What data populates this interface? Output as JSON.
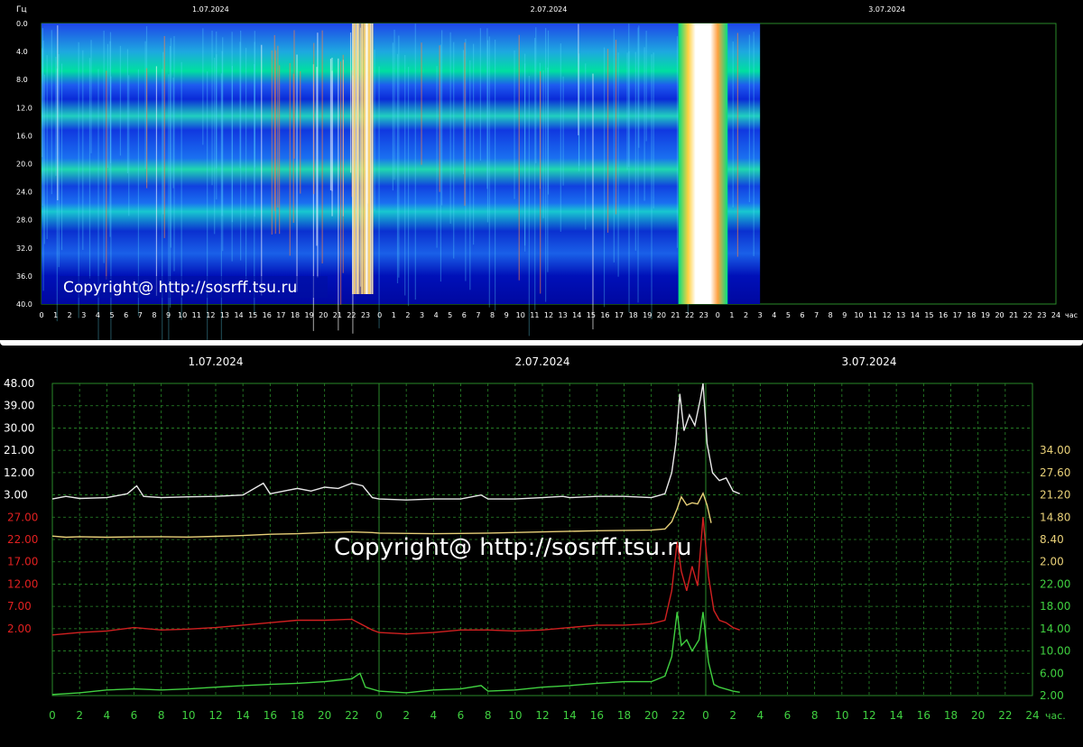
{
  "spectrogram": {
    "ylabel": "Гц",
    "y_ticks": [
      "0.0",
      "4.0",
      "8.0",
      "12.0",
      "16.0",
      "20.0",
      "24.0",
      "28.0",
      "32.0",
      "36.0",
      "40.0"
    ],
    "dates": [
      "1.07.2024",
      "2.07.2024",
      "3.07.2024"
    ],
    "x_tick_labels": [
      "0",
      "1",
      "2",
      "3",
      "4",
      "5",
      "6",
      "7",
      "8",
      "9",
      "10",
      "11",
      "12",
      "13",
      "14",
      "15",
      "16",
      "17",
      "18",
      "19",
      "20",
      "21",
      "22",
      "23",
      "0",
      "1",
      "2",
      "3",
      "4",
      "5",
      "6",
      "7",
      "8",
      "9",
      "10",
      "11",
      "12",
      "13",
      "14",
      "15",
      "16",
      "17",
      "18",
      "19",
      "20",
      "21",
      "22",
      "23",
      "0",
      "1",
      "2",
      "3",
      "4",
      "5",
      "6",
      "7",
      "8",
      "9",
      "10",
      "11",
      "12",
      "13",
      "14",
      "15",
      "16",
      "17",
      "18",
      "19",
      "20",
      "21",
      "22",
      "23",
      "24"
    ],
    "x_unit": "час",
    "copyright": "Copyright@ http://sosrff.tsu.ru",
    "data_end_hour": 51,
    "resonance_bands_hz": [
      7.8,
      14.1,
      20.3,
      26.4,
      32.5
    ],
    "colors": {
      "background": "#0000b4",
      "band": "#00d8a0",
      "burst": "#ffffff",
      "grid": "#30a030"
    }
  },
  "chart_data": {
    "type": "line",
    "title": "",
    "dates": [
      "1.07.2024",
      "2.07.2024",
      "3.07.2024"
    ],
    "x_tick_labels": [
      "0",
      "2",
      "4",
      "6",
      "8",
      "10",
      "12",
      "14",
      "16",
      "18",
      "20",
      "22",
      "0",
      "2",
      "4",
      "6",
      "8",
      "10",
      "12",
      "14",
      "16",
      "18",
      "20",
      "22",
      "0",
      "2",
      "4",
      "6",
      "8",
      "10",
      "12",
      "14",
      "16",
      "18",
      "20",
      "22",
      "24"
    ],
    "x_unit": "час.",
    "left_axis_upper_ticks": [
      "48.00",
      "39.00",
      "30.00",
      "21.00",
      "12.00",
      "3.00"
    ],
    "left_axis_lower_ticks": [
      "27.00",
      "22.00",
      "17.00",
      "12.00",
      "7.00",
      "2.00"
    ],
    "right_axis_upper_ticks": [
      "34.00",
      "27.60",
      "21.20",
      "14.80",
      "8.40",
      "2.00"
    ],
    "right_axis_lower_ticks": [
      "22.00",
      "18.00",
      "14.00",
      "10.00",
      "6.00",
      "2.00"
    ],
    "copyright": "Copyright@ http://sosrff.tsu.ru",
    "series": [
      {
        "color": "#e8e8e8",
        "points": [
          [
            0,
            4
          ],
          [
            1,
            5
          ],
          [
            2,
            4.2
          ],
          [
            4,
            4.5
          ],
          [
            5.5,
            6
          ],
          [
            6.2,
            9
          ],
          [
            6.7,
            5
          ],
          [
            8,
            4.5
          ],
          [
            10,
            4.8
          ],
          [
            12,
            5
          ],
          [
            14,
            5.5
          ],
          [
            15.5,
            10
          ],
          [
            16,
            6
          ],
          [
            17,
            7
          ],
          [
            18,
            8
          ],
          [
            19,
            7
          ],
          [
            20,
            8.5
          ],
          [
            21,
            8
          ],
          [
            22,
            10
          ],
          [
            22.8,
            9
          ],
          [
            23.5,
            4.5
          ],
          [
            24,
            4
          ],
          [
            26,
            3.6
          ],
          [
            28,
            4
          ],
          [
            30,
            4
          ],
          [
            31.5,
            5.5
          ],
          [
            32,
            4
          ],
          [
            34,
            4
          ],
          [
            36,
            4.5
          ],
          [
            37.5,
            5
          ],
          [
            38,
            4.5
          ],
          [
            40,
            5
          ],
          [
            42,
            5
          ],
          [
            44,
            4.5
          ],
          [
            45,
            6
          ],
          [
            45.5,
            14
          ],
          [
            45.8,
            25
          ],
          [
            46.1,
            44
          ],
          [
            46.4,
            30
          ],
          [
            46.8,
            36
          ],
          [
            47.2,
            32
          ],
          [
            47.6,
            42
          ],
          [
            47.8,
            49
          ],
          [
            48.1,
            25
          ],
          [
            48.5,
            14
          ],
          [
            49,
            11
          ],
          [
            49.5,
            12
          ],
          [
            50,
            7
          ],
          [
            50.5,
            6
          ]
        ]
      },
      {
        "color": "#e8d078",
        "points": [
          [
            0,
            19
          ],
          [
            1,
            18
          ],
          [
            2,
            18.5
          ],
          [
            4,
            18
          ],
          [
            6,
            18.3
          ],
          [
            8,
            18.5
          ],
          [
            10,
            18.2
          ],
          [
            12,
            18.8
          ],
          [
            14,
            19.5
          ],
          [
            16,
            20.5
          ],
          [
            18,
            21
          ],
          [
            20,
            22
          ],
          [
            22,
            22.5
          ],
          [
            23.5,
            22
          ],
          [
            24,
            21.5
          ],
          [
            28,
            21
          ],
          [
            32,
            21.5
          ],
          [
            36,
            22.5
          ],
          [
            40,
            23.5
          ],
          [
            44,
            24
          ],
          [
            45,
            25
          ],
          [
            45.5,
            31
          ],
          [
            45.9,
            42
          ],
          [
            46.2,
            52
          ],
          [
            46.6,
            45
          ],
          [
            47,
            47
          ],
          [
            47.4,
            46
          ],
          [
            47.8,
            55
          ],
          [
            48.1,
            45
          ],
          [
            48.4,
            30
          ]
        ]
      },
      {
        "color": "#d02020",
        "points": [
          [
            0,
            3
          ],
          [
            2,
            3.5
          ],
          [
            4,
            3.8
          ],
          [
            6,
            4.5
          ],
          [
            8,
            4
          ],
          [
            10,
            4.2
          ],
          [
            12,
            4.5
          ],
          [
            14,
            5
          ],
          [
            16,
            5.5
          ],
          [
            18,
            6
          ],
          [
            20,
            6
          ],
          [
            22,
            6.2
          ],
          [
            23.5,
            4
          ],
          [
            24,
            3.5
          ],
          [
            26,
            3.2
          ],
          [
            28,
            3.5
          ],
          [
            30,
            4
          ],
          [
            32,
            4
          ],
          [
            34,
            3.8
          ],
          [
            36,
            4
          ],
          [
            38,
            4.5
          ],
          [
            40,
            5
          ],
          [
            42,
            5
          ],
          [
            44,
            5.3
          ],
          [
            45,
            6
          ],
          [
            45.5,
            12
          ],
          [
            45.9,
            22
          ],
          [
            46.2,
            16
          ],
          [
            46.6,
            12
          ],
          [
            47,
            17
          ],
          [
            47.4,
            13
          ],
          [
            47.8,
            27
          ],
          [
            48.2,
            15
          ],
          [
            48.6,
            8
          ],
          [
            49,
            6
          ],
          [
            49.5,
            5.5
          ],
          [
            50,
            4.5
          ],
          [
            50.5,
            4
          ]
        ]
      },
      {
        "color": "#40d040",
        "points": [
          [
            0,
            2.2
          ],
          [
            2,
            2.5
          ],
          [
            4,
            3
          ],
          [
            6,
            3.2
          ],
          [
            8,
            3
          ],
          [
            10,
            3.2
          ],
          [
            12,
            3.5
          ],
          [
            14,
            3.8
          ],
          [
            16,
            4
          ],
          [
            18,
            4.2
          ],
          [
            20,
            4.5
          ],
          [
            22,
            5
          ],
          [
            22.6,
            6
          ],
          [
            23,
            3.5
          ],
          [
            24,
            2.8
          ],
          [
            26,
            2.5
          ],
          [
            28,
            3
          ],
          [
            30,
            3.2
          ],
          [
            31.5,
            3.8
          ],
          [
            32,
            2.8
          ],
          [
            34,
            3
          ],
          [
            36,
            3.5
          ],
          [
            38,
            3.8
          ],
          [
            40,
            4.2
          ],
          [
            42,
            4.5
          ],
          [
            44,
            4.5
          ],
          [
            45,
            5.5
          ],
          [
            45.5,
            9
          ],
          [
            45.9,
            17
          ],
          [
            46.2,
            11
          ],
          [
            46.6,
            12
          ],
          [
            47,
            10
          ],
          [
            47.5,
            12
          ],
          [
            47.8,
            17
          ],
          [
            48.2,
            8
          ],
          [
            48.6,
            4
          ],
          [
            49,
            3.5
          ],
          [
            50,
            2.8
          ],
          [
            50.5,
            2.6
          ]
        ]
      }
    ],
    "series_axis_ranges": [
      [
        3,
        48
      ],
      [
        3,
        48
      ],
      [
        2,
        27
      ],
      [
        2,
        22
      ]
    ]
  }
}
